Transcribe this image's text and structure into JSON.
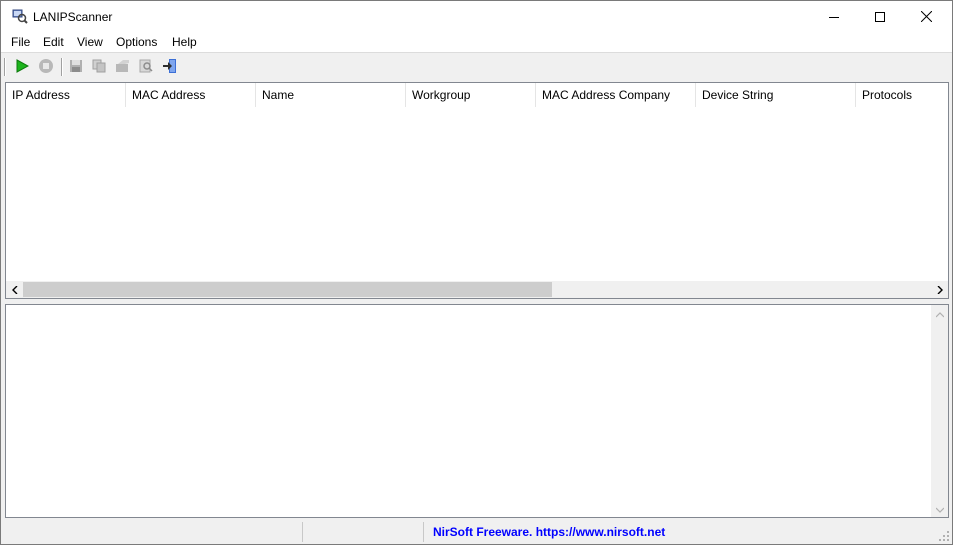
{
  "window": {
    "title": "LANIPScanner",
    "icon": "scanner-app-icon",
    "controls": [
      "minimize-icon",
      "maximize-icon",
      "close-icon"
    ]
  },
  "menu": {
    "items": [
      "File",
      "Edit",
      "View",
      "Options",
      "Help"
    ]
  },
  "toolbar": {
    "buttons": [
      {
        "name": "start-scan",
        "icon": "play-icon",
        "enabled": true,
        "color": "#1db41d"
      },
      {
        "name": "stop-scan",
        "icon": "stop-icon",
        "enabled": false
      },
      {
        "name": "save-selected",
        "icon": "save-icon",
        "enabled": false
      },
      {
        "name": "copy-selected",
        "icon": "copy-icon",
        "enabled": false
      },
      {
        "name": "properties",
        "icon": "properties-icon",
        "enabled": false
      },
      {
        "name": "find",
        "icon": "find-icon",
        "enabled": false
      },
      {
        "name": "exit",
        "icon": "exit-icon",
        "enabled": true
      }
    ]
  },
  "list": {
    "columns": [
      "IP Address",
      "MAC Address",
      "Name",
      "Workgroup",
      "MAC Address Company",
      "Device String",
      "Protocols"
    ],
    "rows": []
  },
  "statusbar": {
    "panels": [
      "",
      "",
      "NirSoft Freeware. https://www.nirsoft.net"
    ],
    "link_color": "#0000ff"
  },
  "colors": {
    "window_bg": "#f0f0f0",
    "list_bg": "#ffffff",
    "scroll_thumb": "#cdcdcd"
  }
}
